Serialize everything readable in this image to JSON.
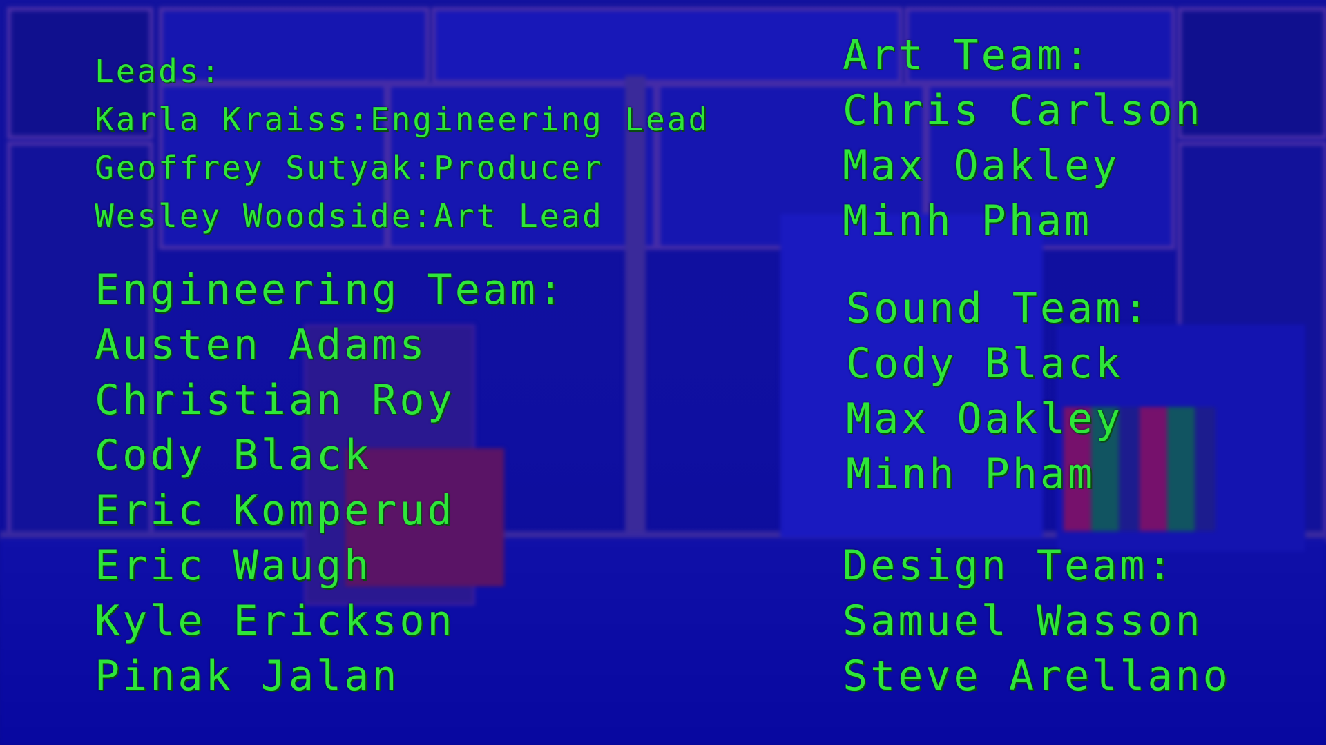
{
  "leads": {
    "heading": "Leads:",
    "members": [
      "Karla Kraiss:Engineering Lead",
      "Geoffrey Sutyak:Producer",
      "Wesley Woodside:Art Lead"
    ]
  },
  "engineering": {
    "heading": "Engineering Team:",
    "members": [
      "Austen Adams",
      "Christian Roy",
      "Cody Black",
      "Eric Komperud",
      "Eric Waugh",
      "Kyle Erickson",
      "Pinak Jalan"
    ]
  },
  "art": {
    "heading": "Art Team:",
    "members": [
      "Chris Carlson",
      "Max Oakley",
      "Minh Pham"
    ]
  },
  "sound": {
    "heading": "Sound Team:",
    "members": [
      "Cody Black",
      "Max Oakley",
      "Minh Pham"
    ]
  },
  "design": {
    "heading": "Design Team:",
    "members": [
      "Samuel Wasson",
      "Steve Arellano"
    ]
  },
  "colors": {
    "text": "#2ee63a",
    "background": "#12129e",
    "frame": "#4f2fa0"
  }
}
